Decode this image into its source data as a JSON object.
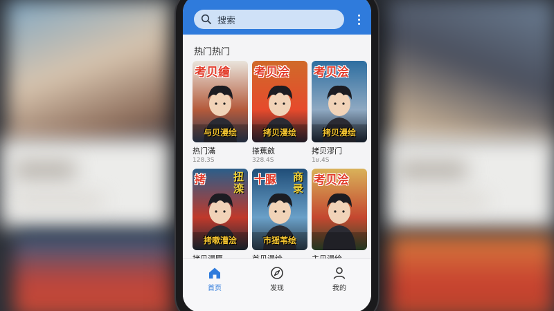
{
  "search": {
    "placeholder": "搜索"
  },
  "section": {
    "title": "热门热门"
  },
  "comics": [
    {
      "title": "热门滿",
      "meta": "128.3S",
      "cover_text": "考贝繪",
      "cover_sub": "与贝漫绘",
      "palette": [
        "#e9e4dc",
        "#b45a3b",
        "#2b3a52"
      ]
    },
    {
      "title": "搽蕉斂",
      "meta": "328.4S",
      "cover_text": "考贝浍",
      "cover_sub": "拷贝漫绘",
      "palette": [
        "#d06a2a",
        "#e64a2c",
        "#2b2430"
      ]
    },
    {
      "title": "拷贝漻门",
      "meta": "1ʁ.4S",
      "cover_text": "考贝浍",
      "cover_sub": "拷贝漫绘",
      "palette": [
        "#2d6ea0",
        "#8fa9c2",
        "#1a2433"
      ]
    },
    {
      "title": "拷贝漫匾",
      "meta": "",
      "cover_text": "拷",
      "cover_sub": "拷嗽漕浍",
      "cover_side": "扭滦",
      "palette": [
        "#2b5e8a",
        "#c0392b",
        "#1d2a36"
      ]
    },
    {
      "title": "首贝漫绘",
      "meta": "",
      "cover_text": "十脲",
      "cover_sub": "市猺苇绘",
      "cover_side": "商录",
      "palette": [
        "#1f4d78",
        "#6aa0c8",
        "#2b3b4a"
      ]
    },
    {
      "title": "主贝漫绘",
      "meta": "",
      "cover_text": "考贝浍",
      "cover_sub": "",
      "palette": [
        "#d9b25a",
        "#c4472f",
        "#2f4a2c"
      ]
    }
  ],
  "tabs": [
    {
      "label": "首页",
      "icon": "home-icon",
      "active": true
    },
    {
      "label": "发现",
      "icon": "compass-icon",
      "active": false
    },
    {
      "label": "我的",
      "icon": "user-icon",
      "active": false
    }
  ],
  "colors": {
    "accent": "#2f7bdc",
    "cover_title": "#e23b2a"
  }
}
